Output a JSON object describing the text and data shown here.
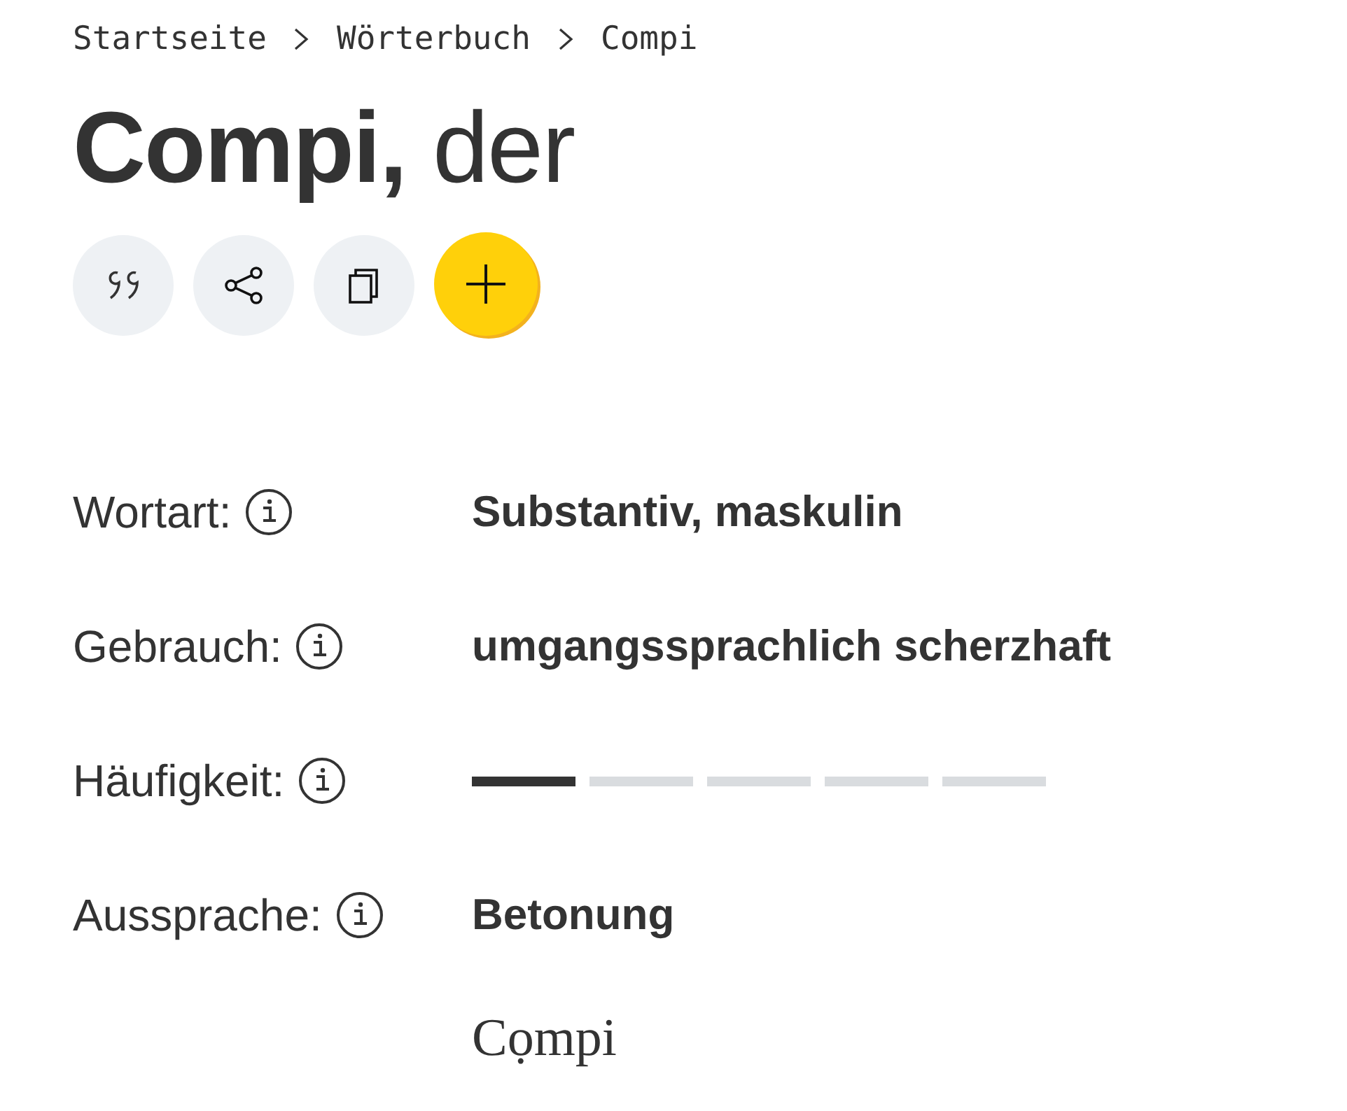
{
  "breadcrumb": [
    "Startseite",
    "Wörterbuch",
    "Compi"
  ],
  "headword": "**Compi,** der",
  "actions": [
    {
      "kind": "quote"
    },
    {
      "kind": "share"
    },
    {
      "kind": "copy"
    },
    {
      "kind": "add"
    }
  ],
  "details": [
    {
      "kind": "text",
      "label": "Wortart:",
      "value": "Substantiv, maskulin"
    },
    {
      "kind": "text",
      "label": "Gebrauch:",
      "value": "umgangssprachlich scherzhaft"
    },
    {
      "kind": "frequency",
      "label": "Häufigkeit:",
      "level": 0.2
    },
    {
      "kind": "pronunciation",
      "label": "Aussprache:",
      "value": "Betonung",
      "stress": "Cọmpi"
    }
  ]
}
